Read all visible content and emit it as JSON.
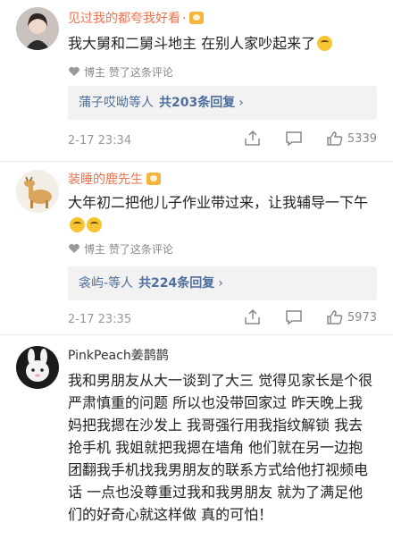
{
  "comments": [
    {
      "username": "见过我的都夸我好看",
      "text": "我大舅和二舅斗地主 在别人家吵起来了",
      "liked_by": "博主 赞了这条评论",
      "reply_names": "蒲子哎呦等人",
      "reply_count": "共203条回复",
      "time": "2-17 23:34",
      "likes": "5339"
    },
    {
      "username": "装睡的鹿先生",
      "text": "大年初二把他儿子作业带过来，让我辅导一下午",
      "liked_by": "博主 赞了这条评论",
      "reply_names": "衾屿-等人",
      "reply_count": "共224条回复",
      "time": "2-17 23:35",
      "likes": "5973"
    },
    {
      "username": "PinkPeach姜鹊鹊",
      "text": "我和男朋友从大一谈到了大三 觉得见家长是个很严肃慎重的问题 所以也没带回家过 昨天晚上我妈把我摁在沙发上 我哥强行用我指纹解锁 我去抢手机 我姐就把我摁在墙角 他们就在另一边抱团翻我手机找我男朋友的联系方式给他打视频电话 一点也没尊重过我和我男朋友 就为了满足他们的好奇心就这样做 真的可怕！"
    }
  ],
  "icons": {
    "comment": "comment-icon",
    "share": "share-icon",
    "like": "thumbs-up-icon",
    "liked_by": "heart-icon"
  },
  "colors": {
    "username": "#eb7350",
    "link": "#4e6e9b"
  }
}
